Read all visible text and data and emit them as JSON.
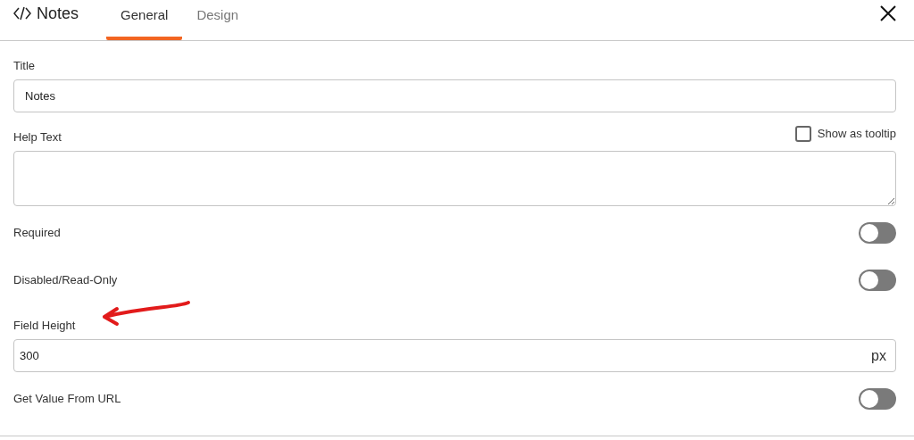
{
  "header": {
    "title": "Notes"
  },
  "tabs": [
    {
      "label": "General",
      "selected": true
    },
    {
      "label": "Design",
      "selected": false
    }
  ],
  "fields": [
    {
      "kind": "text",
      "label": "Title",
      "value": "Notes",
      "annotated": false
    },
    {
      "kind": "textarea",
      "label": "Help Text",
      "option": {
        "label": "Show as tooltip",
        "checked": false
      },
      "annotated": false
    },
    {
      "kind": "toggle",
      "label": "Required",
      "on": false,
      "annotated": false
    },
    {
      "kind": "toggle",
      "label": "Disabled/Read-Only",
      "on": false,
      "annotated": false
    },
    {
      "kind": "unit",
      "label": "Field Height",
      "value": "300",
      "unit": "px",
      "annotated": true
    },
    {
      "kind": "toggle",
      "label": "Get Value From URL",
      "on": false,
      "annotated": false
    }
  ]
}
